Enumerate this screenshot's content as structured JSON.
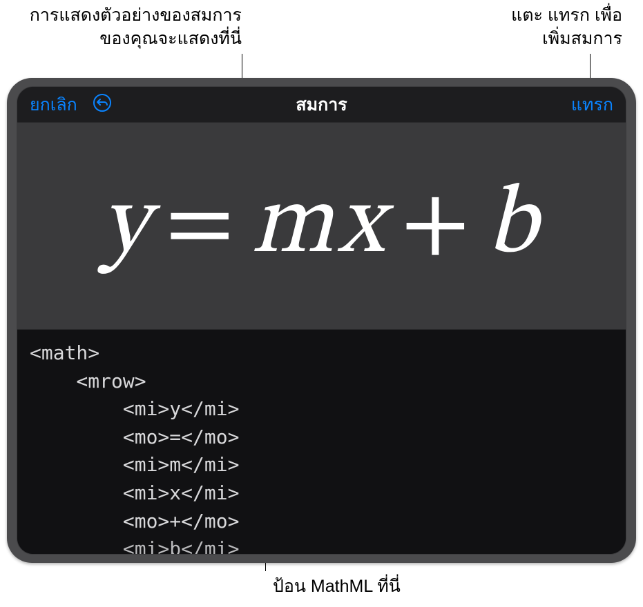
{
  "annotations": {
    "top_left": "การแสดงตัวอย่างของสมการ\nของคุณจะแสดงที่นี่",
    "top_right": "แตะ แทรก เพื่อ\nเพิ่มสมการ",
    "bottom": "ป้อน MathML ที่นี่"
  },
  "header": {
    "cancel_label": "ยกเลิก",
    "title": "สมการ",
    "insert_label": "แทรก",
    "undo_icon_name": "undo-icon"
  },
  "equation_preview": {
    "tokens": [
      "y",
      "=",
      "m",
      "x",
      "+",
      "b"
    ]
  },
  "code": {
    "lines": [
      "<math>",
      "    <mrow>",
      "        <mi>y</mi>",
      "        <mo>=</mo>",
      "        <mi>m</mi>",
      "        <mi>x</mi>",
      "        <mo>+</mo>",
      "        <mi>b</mi>"
    ]
  }
}
